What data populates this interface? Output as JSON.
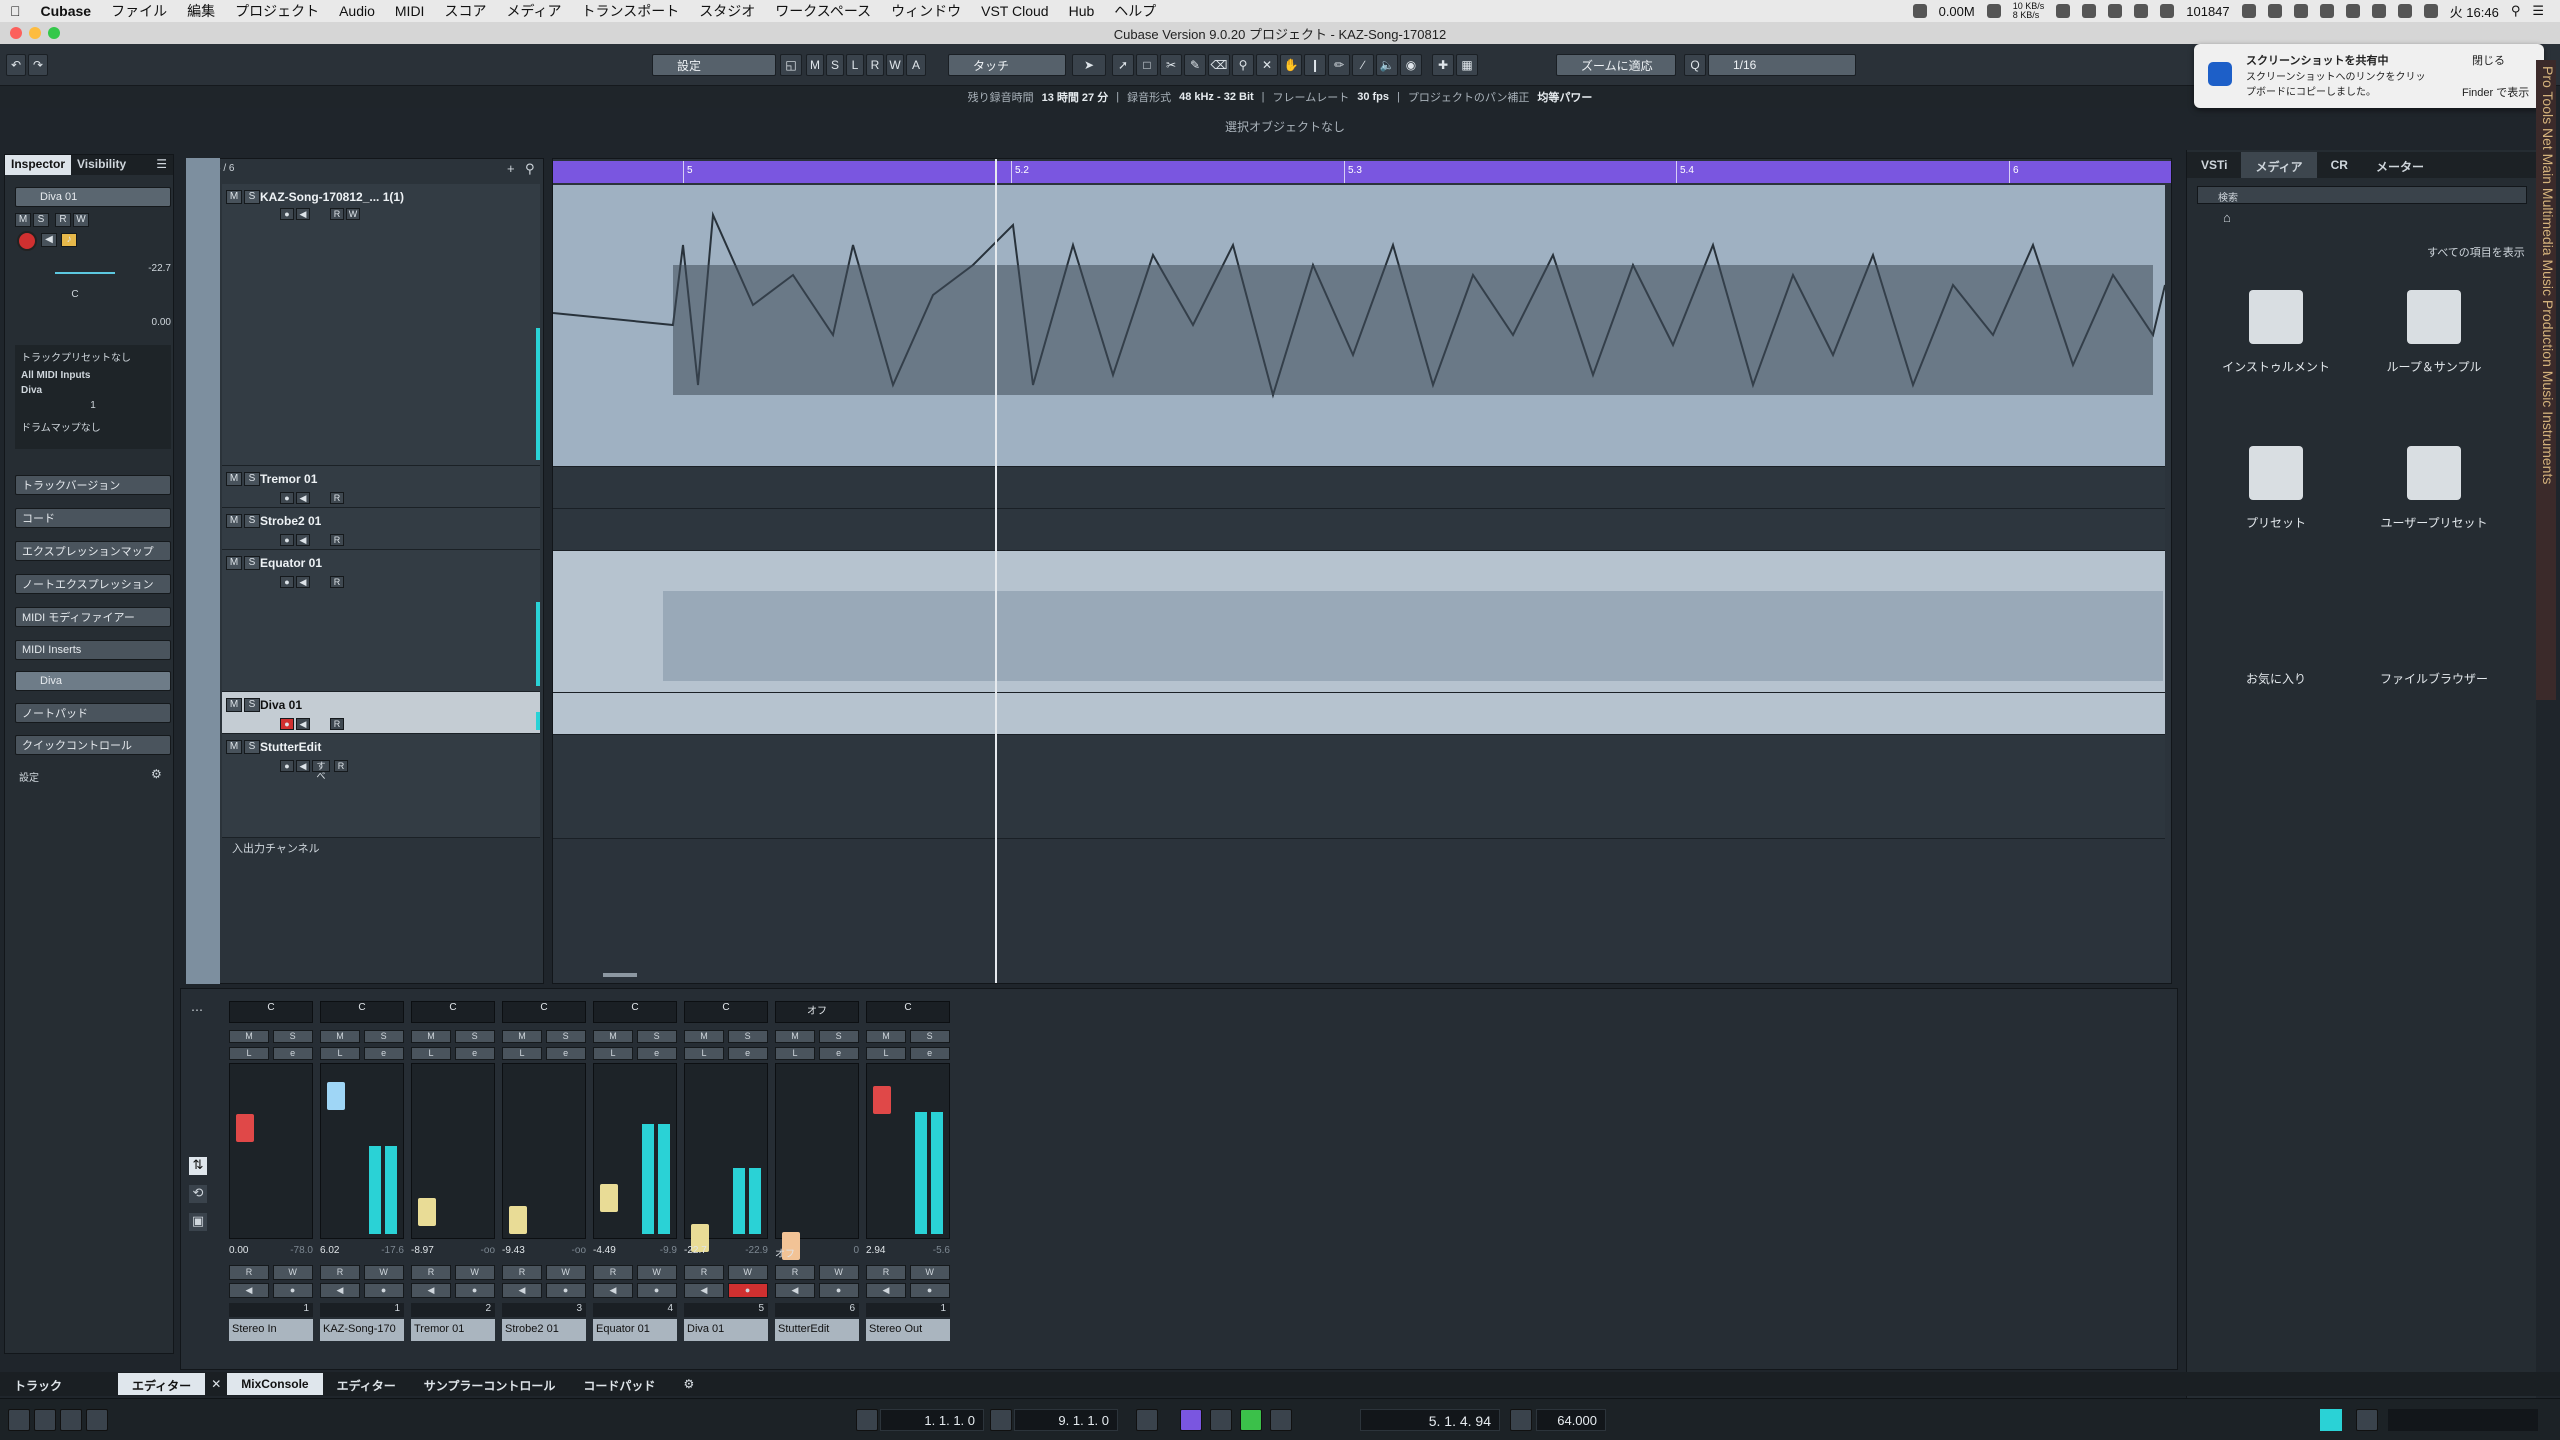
{
  "menubar": {
    "apple": "",
    "app": "Cubase",
    "items": [
      "ファイル",
      "編集",
      "プロジェクト",
      "Audio",
      "MIDI",
      "スコア",
      "メディア",
      "トランスポート",
      "スタジオ",
      "ワークスペース",
      "ウィンドウ",
      "VST Cloud",
      "Hub",
      "ヘルプ"
    ],
    "status": {
      "mem": "0.00M",
      "net_up": "10 KB/s",
      "net_down": "8 KB/s",
      "count": "101847",
      "clock": "火 16:46"
    }
  },
  "window": {
    "title": "Cubase Version 9.0.20 プロジェクト - KAZ-Song-170812"
  },
  "toolbar": {
    "preset": "設定",
    "msrwa": [
      "M",
      "S",
      "L",
      "R",
      "W",
      "A"
    ],
    "automation_mode": "タッチ",
    "zoom_mode": "ズームに適応",
    "quantize": "1/16"
  },
  "infoline": {
    "rec_time_label": "残り録音時間",
    "rec_time": "13 時間 27 分",
    "format_label": "録音形式",
    "format": "48 kHz - 32 Bit",
    "framerate_label": "フレームレート",
    "framerate": "30 fps",
    "pan_label": "プロジェクトのパン補正",
    "pan": "均等パワー",
    "selection": "選択オブジェクトなし"
  },
  "notification": {
    "title": "スクリーンショットを共有中",
    "body": "スクリーンショットへのリンクをクリップボードにコピーしました。",
    "close": "閉じる",
    "finder": "Finder で表示"
  },
  "side_banner": "Pro Tools Net  Main Multimedia Music Production Music Instruments",
  "inspector": {
    "tabs": [
      "Inspector",
      "Visibility"
    ],
    "track_name": "Diva 01",
    "volume": "-22.7",
    "pan": "C",
    "delay": "0.00",
    "preset_label": "トラックプリセットなし",
    "input": "All MIDI Inputs",
    "output": "Diva",
    "channel": "1",
    "drummap": "ドラムマップなし",
    "sections": [
      "トラックバージョン",
      "コード",
      "エクスプレッションマップ",
      "ノートエクスプレッション",
      "MIDI モディファイアー",
      "MIDI Inserts",
      "Diva",
      "ノートパッド",
      "クイックコントロール"
    ],
    "settings": "設定"
  },
  "tracklist": {
    "header_count": "6 / 6",
    "tracks": [
      {
        "num": "1",
        "name": "KAZ-Song-170812_... 1(1)"
      },
      {
        "num": "2",
        "name": "Tremor 01"
      },
      {
        "num": "3",
        "name": "Strobe2 01"
      },
      {
        "num": "4",
        "name": "Equator 01"
      },
      {
        "num": "5",
        "name": "Diva 01"
      },
      {
        "num": "6",
        "name": "StutterEdit"
      }
    ],
    "io_channels": "入出力チャンネル",
    "stutter_btn": "すべ"
  },
  "ruler": {
    "ticks": [
      "5",
      "5.2",
      "5.3",
      "5.4",
      "6"
    ]
  },
  "media": {
    "tabs": [
      "VSTi",
      "メディア",
      "CR",
      "メーター"
    ],
    "search_placeholder": "検索",
    "show_all": "すべての項目を表示",
    "tiles": [
      "インストゥルメント",
      "ループ＆サンプル",
      "プリセット",
      "ユーザープリセット",
      "お気に入り",
      "ファイルブラウザー"
    ]
  },
  "mixer": {
    "strips": [
      {
        "pan": "C",
        "value": "0.00",
        "peak": "-78.0",
        "num": "1",
        "name": "Stereo In",
        "color": "#e04848",
        "rw": true
      },
      {
        "pan": "C",
        "value": "6.02",
        "peak": "-17.6",
        "num": "1",
        "name": "KAZ-Song-170",
        "color": "#9fd6f6",
        "rw": true
      },
      {
        "pan": "C",
        "value": "-8.97",
        "peak": "-oo",
        "num": "2",
        "name": "Tremor 01",
        "color": "#e9dc96",
        "rw": true
      },
      {
        "pan": "C",
        "value": "-9.43",
        "peak": "-oo",
        "num": "3",
        "name": "Strobe2 01",
        "color": "#e9dc96",
        "rw": true
      },
      {
        "pan": "C",
        "value": "-4.49",
        "peak": "-9.9",
        "num": "4",
        "name": "Equator 01",
        "color": "#e9dc96",
        "rw": true
      },
      {
        "pan": "C",
        "value": "-22.7",
        "peak": "-22.9",
        "num": "5",
        "name": "Diva 01",
        "color": "#e9dc96",
        "rw": true
      },
      {
        "pan": "オフ",
        "value": "オフ",
        "peak": "0",
        "num": "6",
        "name": "StutterEdit",
        "color": "#f2c396",
        "rw": true
      },
      {
        "pan": "C",
        "value": "2.94",
        "peak": "-5.6",
        "num": "1",
        "name": "Stereo Out",
        "color": "#e04848",
        "rw": true
      }
    ],
    "scale": [
      "6",
      "0",
      "-5",
      "-10",
      "-15",
      "-20",
      "-30",
      "-40",
      "-50"
    ]
  },
  "zonetabs": {
    "left": [
      "トラック",
      "エディター"
    ],
    "bottom": [
      "MixConsole",
      "エディター",
      "サンプラーコントロール",
      "コードパッド"
    ]
  },
  "transport": {
    "left_locator": "1. 1. 1.   0",
    "right_locator": "9. 1. 1.   0",
    "position": "5. 1. 4.  94",
    "tempo": "64.000"
  }
}
